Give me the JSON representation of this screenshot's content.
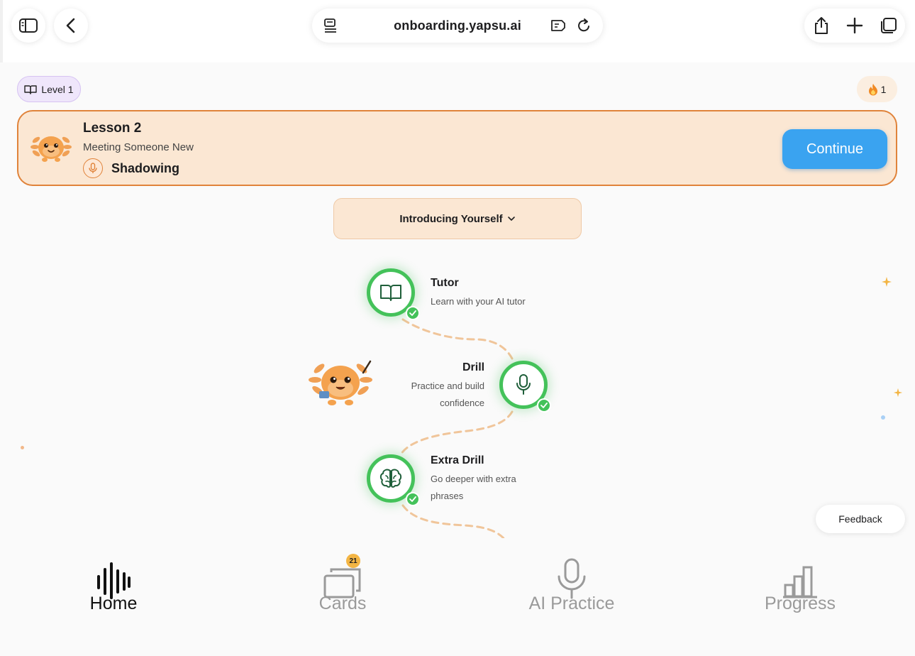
{
  "browser": {
    "url": "onboarding.yapsu.ai",
    "icons": [
      "sidebar-icon",
      "back-icon",
      "reader-icon",
      "extension-icon",
      "reload-icon",
      "share-icon",
      "new-tab-icon",
      "tabs-icon"
    ]
  },
  "header": {
    "level_label": "Level 1",
    "streak_count": "1"
  },
  "lesson": {
    "title": "Lesson 2",
    "subtitle": "Meeting Someone New",
    "mode": "Shadowing",
    "continue_label": "Continue"
  },
  "section": {
    "selected": "Introducing Yourself"
  },
  "path": {
    "nodes": [
      {
        "title": "Tutor",
        "desc": "Learn with your AI tutor",
        "icon": "book-icon",
        "completed": true
      },
      {
        "title": "Drill",
        "desc_line1": "Practice and build",
        "desc_line2": "confidence",
        "icon": "microphone-icon",
        "completed": true
      },
      {
        "title": "Extra Drill",
        "desc_line1": "Go deeper with extra",
        "desc_line2": "phrases",
        "icon": "brain-icon",
        "completed": true
      }
    ]
  },
  "feedback_label": "Feedback",
  "nav": {
    "items": [
      {
        "label": "Home",
        "icon": "waveform-icon",
        "active": true
      },
      {
        "label": "Cards",
        "icon": "cards-icon",
        "badge": "21"
      },
      {
        "label": "AI Practice",
        "icon": "microphone-icon"
      },
      {
        "label": "Progress",
        "icon": "bar-chart-icon"
      }
    ]
  },
  "colors": {
    "accent_orange": "#e0833a",
    "card_bg": "#fbe7d3",
    "continue_blue": "#3aa3f0",
    "complete_green": "#44c25a",
    "level_purple_bg": "#efe6fb"
  }
}
